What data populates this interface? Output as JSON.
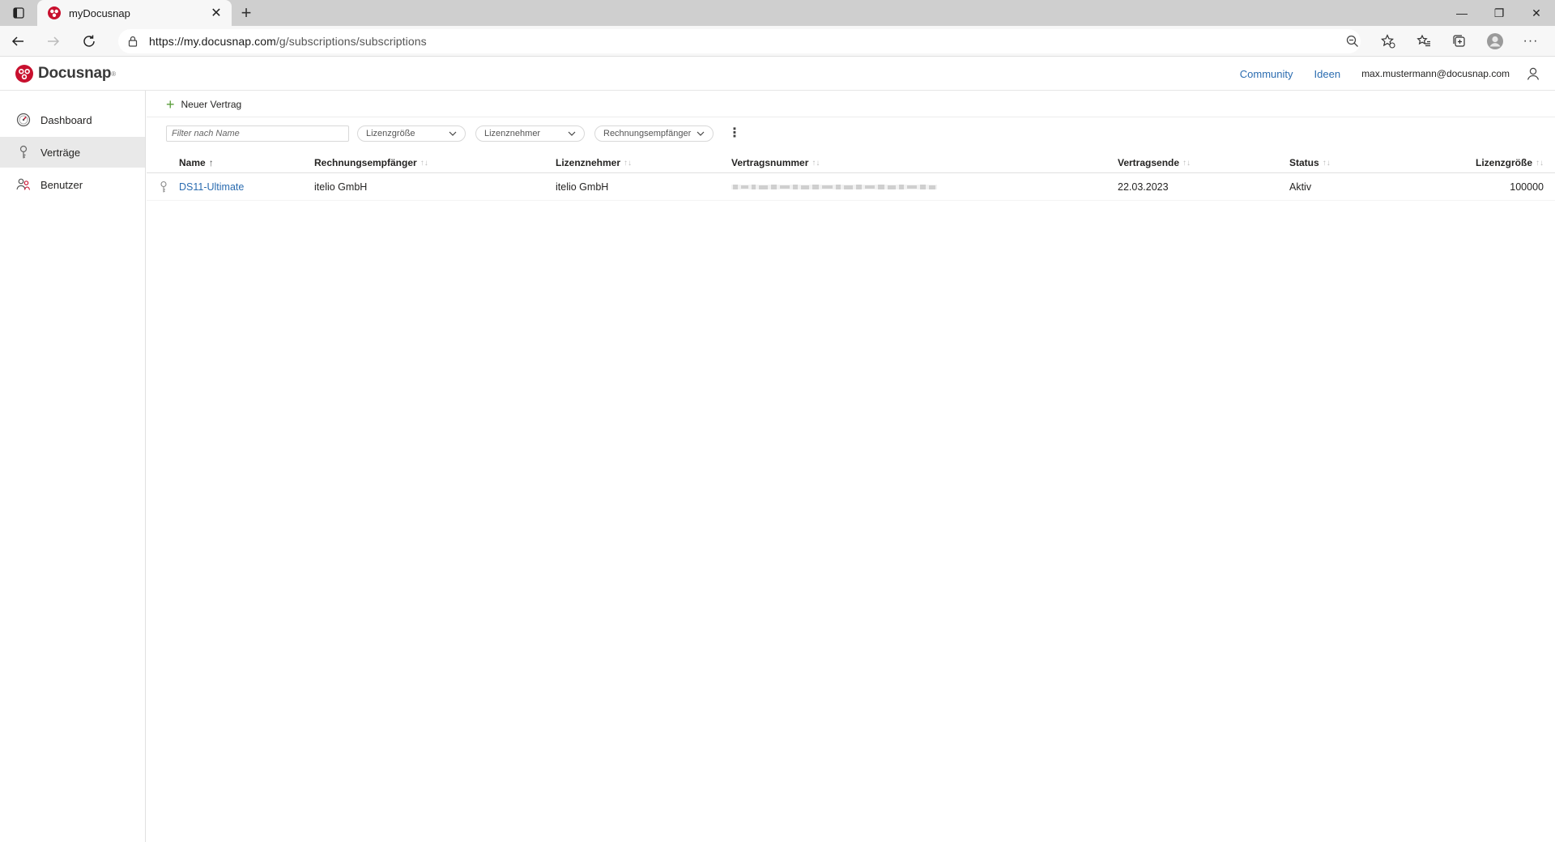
{
  "browser": {
    "tab_title": "myDocusnap",
    "url_host": "https://my.docusnap.com",
    "url_path": "/g/subscriptions/subscriptions"
  },
  "header": {
    "brand": "Docusnap",
    "brand_reg": "®",
    "community": "Community",
    "ideas": "Ideen",
    "email": "max.mustermann@docusnap.com"
  },
  "sidebar": {
    "items": [
      {
        "label": "Dashboard",
        "icon": "speedometer-icon"
      },
      {
        "label": "Verträge",
        "icon": "key-icon"
      },
      {
        "label": "Benutzer",
        "icon": "users-icon"
      }
    ]
  },
  "toolbar": {
    "new_contract": "Neuer Vertrag"
  },
  "filters": {
    "name_placeholder": "Filter nach Name",
    "license_size": "Lizenzgröße",
    "licensee": "Lizenznehmer",
    "invoice_recipient": "Rechnungsempfänger"
  },
  "table": {
    "columns": [
      "Name",
      "Rechnungsempfänger",
      "Lizenznehmer",
      "Vertragsnummer",
      "Vertragsende",
      "Status",
      "Lizenzgröße"
    ],
    "sort_asc": "↑",
    "sort_none": "↑↓",
    "rows": [
      {
        "name": "DS11-Ultimate",
        "invoice_recipient": "itelio GmbH",
        "licensee": "itelio GmbH",
        "contract_end": "22.03.2023",
        "status": "Aktiv",
        "license_size": "100000"
      }
    ]
  },
  "colors": {
    "accent_link": "#2b6cb0",
    "brand_red": "#c8102e",
    "add_green": "#5a9e3b",
    "active_nav": "#e9e9e9"
  }
}
